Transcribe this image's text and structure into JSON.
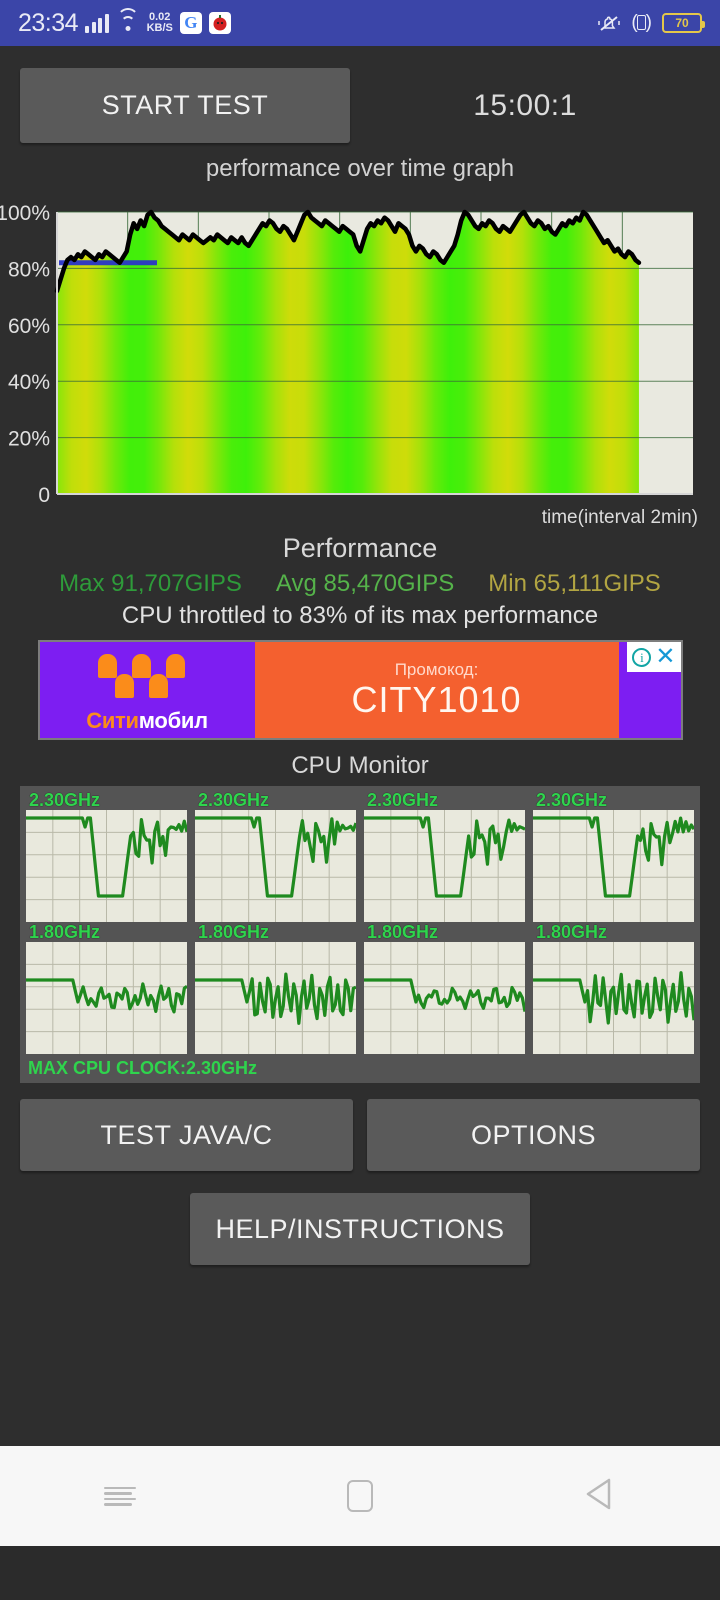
{
  "statusbar": {
    "time": "23:34",
    "net_speed_value": "0.02",
    "net_speed_unit": "KB/S",
    "google_icon": "G",
    "app_icon": "app-badge-icon",
    "signal_icon": "signal-bars-icon",
    "wifi_icon": "wifi-icon",
    "mute_icon": "mute-bell-icon",
    "vibrate_icon": "vibrate-icon",
    "battery_level": "70",
    "bar_color": "#3b45a8",
    "battery_color": "#e4c74a"
  },
  "toolbar": {
    "start_test_label": "START TEST",
    "timer": "15:00:1"
  },
  "chart_data": {
    "type": "area",
    "title": "performance over time graph",
    "xlabel": "time(interval 2min)",
    "ylabel": "",
    "ylim": [
      0,
      100
    ],
    "yticks": [
      "0",
      "20%",
      "40%",
      "60%",
      "80%",
      "100%"
    ],
    "ytick_values": [
      0,
      20,
      40,
      60,
      80,
      100
    ],
    "grid": true,
    "legend": "none",
    "plot_bg": "#e9e9e0",
    "line_color": "#000000",
    "marker_line_color": "#2b35c8",
    "marker_line_value": 82,
    "series": [
      {
        "name": "performance",
        "values": [
          72,
          76,
          80,
          83,
          84,
          83,
          85,
          84,
          86,
          85,
          84,
          83,
          85,
          84,
          86,
          85,
          84,
          83,
          82,
          84,
          86,
          92,
          96,
          94,
          97,
          95,
          99,
          100,
          98,
          97,
          95,
          94,
          93,
          92,
          91,
          90,
          92,
          91,
          90,
          92,
          91,
          90,
          89,
          90,
          91,
          90,
          92,
          91,
          90,
          89,
          91,
          90,
          89,
          91,
          89,
          88,
          90,
          92,
          94,
          96,
          95,
          97,
          96,
          94,
          93,
          95,
          94,
          92,
          90,
          93,
          96,
          99,
          100,
          98,
          97,
          96,
          95,
          97,
          96,
          95,
          94,
          93,
          95,
          94,
          93,
          92,
          88,
          86,
          90,
          94,
          96,
          95,
          97,
          96,
          98,
          97,
          95,
          93,
          96,
          95,
          94,
          92,
          88,
          86,
          88,
          87,
          85,
          84,
          86,
          85,
          83,
          82,
          84,
          86,
          88,
          92,
          97,
          100,
          99,
          97,
          95,
          94,
          96,
          95,
          97,
          96,
          94,
          93,
          95,
          94,
          93,
          95,
          97,
          99,
          100,
          98,
          96,
          95,
          97,
          96,
          94,
          95,
          93,
          92,
          94,
          96,
          95,
          97,
          96,
          98,
          97,
          100,
          99,
          97,
          95,
          93,
          91,
          89,
          90,
          88,
          86,
          87,
          85,
          84,
          86,
          85,
          83,
          82
        ]
      }
    ],
    "x_gridlines": 8
  },
  "performance": {
    "heading": "Performance",
    "max_label": "Max 91,707GIPS",
    "avg_label": "Avg 85,470GIPS",
    "min_label": "Min 65,111GIPS",
    "max_color": "#2e9b3a",
    "avg_color": "#55b34a",
    "min_color": "#b2a542",
    "throttle_note": "CPU throttled to 83% of its max performance"
  },
  "ad": {
    "brand_part1": "Сити",
    "brand_part2": "мобил",
    "promo_label": "Промокод:",
    "promo_code": "CITY1010",
    "info_icon": "info-icon",
    "close_icon": "close-icon"
  },
  "cpu_monitor": {
    "heading": "CPU Monitor",
    "max_clock_label": "MAX CPU CLOCK:2.30GHz",
    "row1": [
      {
        "label": "2.30GHz"
      },
      {
        "label": "2.30GHz"
      },
      {
        "label": "2.30GHz"
      },
      {
        "label": "2.30GHz"
      }
    ],
    "row2": [
      {
        "label": "1.80GHz"
      },
      {
        "label": "1.80GHz"
      },
      {
        "label": "1.80GHz"
      },
      {
        "label": "1.80GHz"
      }
    ]
  },
  "buttons": {
    "test_java_label": "TEST JAVA/C",
    "options_label": "OPTIONS",
    "help_label": "HELP/INSTRUCTIONS"
  },
  "navbar": {
    "menu_icon": "menu-icon",
    "home_icon": "home-icon",
    "back_icon": "back-icon"
  }
}
